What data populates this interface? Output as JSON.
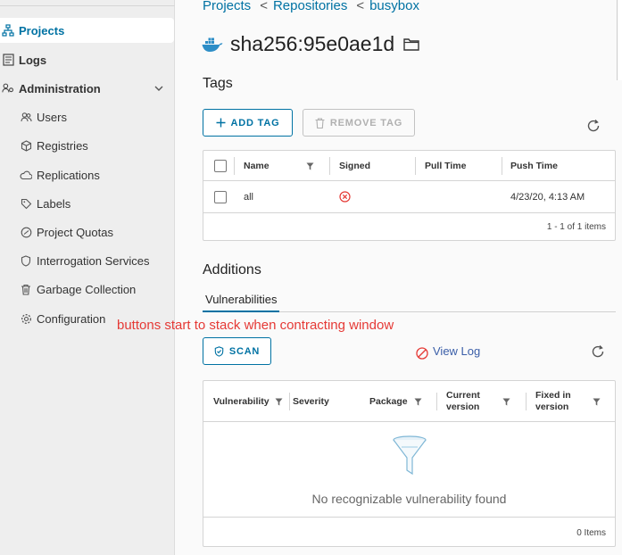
{
  "sidebar": {
    "items": [
      {
        "name": "projects",
        "label": "Projects",
        "icon": "projects-icon",
        "active": true
      },
      {
        "name": "logs",
        "label": "Logs",
        "icon": "logs-icon"
      },
      {
        "name": "administration",
        "label": "Administration",
        "icon": "administration-icon"
      }
    ],
    "admin_items": [
      {
        "label": "Users",
        "icon": "users-icon"
      },
      {
        "label": "Registries",
        "icon": "registries-icon"
      },
      {
        "label": "Replications",
        "icon": "replications-icon"
      },
      {
        "label": "Labels",
        "icon": "labels-icon"
      },
      {
        "label": "Project Quotas",
        "icon": "quotas-icon"
      },
      {
        "label": "Interrogation Services",
        "icon": "shield-icon"
      },
      {
        "label": "Garbage Collection",
        "icon": "trash-icon"
      },
      {
        "label": "Configuration",
        "icon": "gear-icon"
      }
    ]
  },
  "breadcrumb": {
    "items": [
      "Projects",
      "Repositories",
      "busybox"
    ],
    "separator": "<"
  },
  "artifact": {
    "title": "sha256:95e0ae1d"
  },
  "tags": {
    "heading": "Tags",
    "add_label": "ADD TAG",
    "remove_label": "REMOVE TAG",
    "columns": [
      "Name",
      "Signed",
      "Pull Time",
      "Push Time"
    ],
    "rows": [
      {
        "name": "all",
        "signed": "not-signed",
        "pull_time": "",
        "push_time": "4/23/20, 4:13 AM"
      }
    ],
    "footer": "1 - 1 of 1 items"
  },
  "additions": {
    "heading": "Additions",
    "tab": "Vulnerabilities",
    "annotation": "buttons start to stack when contracting window",
    "scan_label": "SCAN",
    "view_log_label": "View Log",
    "columns": [
      "Vulnerability",
      "Severity",
      "Package",
      "Current version",
      "Fixed in version"
    ],
    "empty_text": "No recognizable vulnerability found",
    "footer": "0 Items"
  },
  "colors": {
    "accent": "#0072a3",
    "error": "#e53935",
    "docker_blue": "#2e8ec7"
  }
}
